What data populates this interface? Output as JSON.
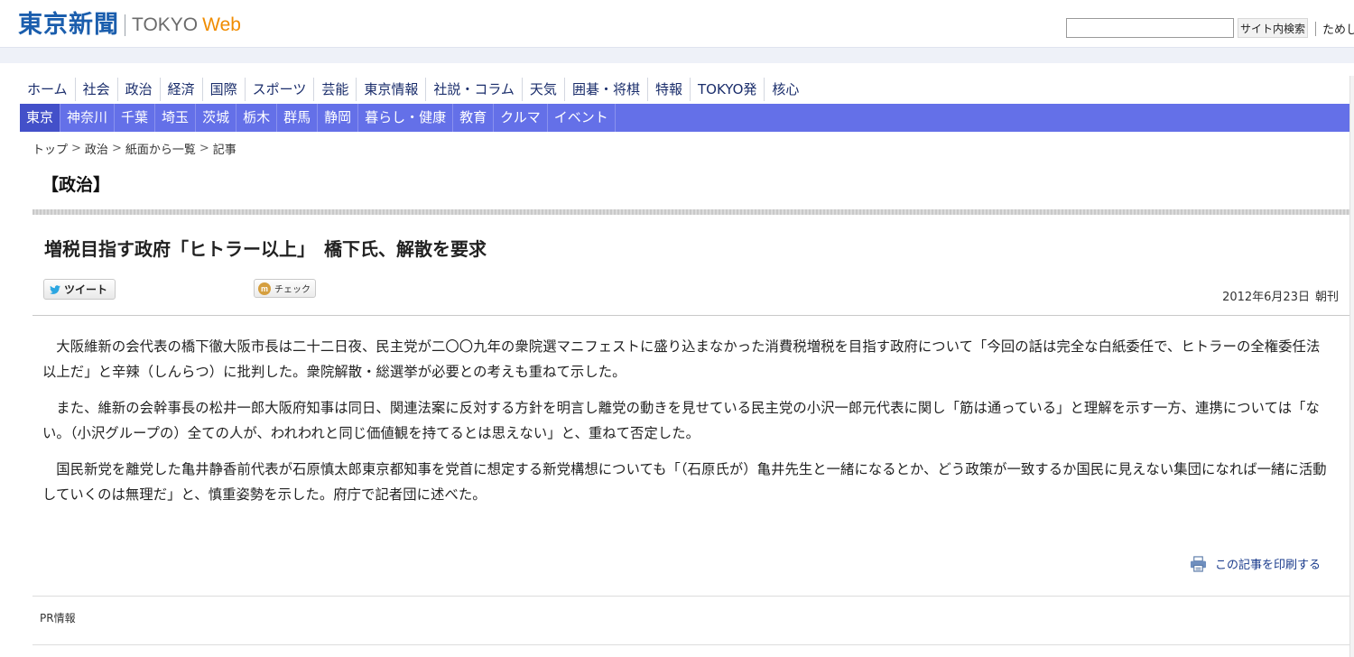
{
  "header": {
    "logo_kanji": "東京新聞",
    "logo_tokyo": "TOKYO",
    "logo_web": "Web",
    "search": {
      "value": "",
      "button_label": "サイト内検索"
    },
    "try_link": "ためし"
  },
  "main_nav": [
    "ホーム",
    "社会",
    "政治",
    "経済",
    "国際",
    "スポーツ",
    "芸能",
    "東京情報",
    "社説・コラム",
    "天気",
    "囲碁・将棋",
    "特報",
    "TOKYO発",
    "核心"
  ],
  "region_nav": [
    "東京",
    "神奈川",
    "千葉",
    "埼玉",
    "茨城",
    "栃木",
    "群馬",
    "静岡",
    "暮らし・健康",
    "教育",
    "クルマ",
    "イベント"
  ],
  "breadcrumb": [
    "トップ",
    "政治",
    "紙面から一覧",
    "記事"
  ],
  "breadcrumb_sep": ">",
  "section_title": "【政治】",
  "article": {
    "headline": "増税目指す政府「ヒトラー以上」　橋下氏、解散を要求",
    "tweet_label": "ツイート",
    "check_label": "チェック",
    "date": "2012年6月23日",
    "edition": "朝刊",
    "paragraphs": [
      "大阪維新の会代表の橋下徹大阪市長は二十二日夜、民主党が二〇〇九年の衆院選マニフェストに盛り込まなかった消費税増税を目指す政府について「今回の話は完全な白紙委任で、ヒトラーの全権委任法以上だ」と辛辣（しんらつ）に批判した。衆院解散・総選挙が必要との考えも重ねて示した。",
      "また、維新の会幹事長の松井一郎大阪府知事は同日、関連法案に反対する方針を明言し離党の動きを見せている民主党の小沢一郎元代表に関し「筋は通っている」と理解を示す一方、連携については「ない。（小沢グループの）全ての人が、われわれと同じ価値観を持てるとは思えない」と、重ねて否定した。",
      "国民新党を離党した亀井静香前代表が石原慎太郎東京都知事を党首に想定する新党構想についても「（石原氏が）亀井先生と一緒になるとか、どう政策が一致するか国民に見えない集団になれば一緒に活動していくのは無理だ」と、慎重姿勢を示した。府庁で記者団に述べた。"
    ],
    "print_label": "この記事を印刷する"
  },
  "pr_label": "PR情報",
  "colors": {
    "logo_blue": "#1b5ead",
    "web_orange": "#f08c00",
    "region_nav_bg": "#6470e8",
    "nav_text": "#1a2d6b"
  },
  "icons": {
    "tweet": "twitter-bird-icon",
    "check": "mixi-icon",
    "print": "printer-icon"
  }
}
